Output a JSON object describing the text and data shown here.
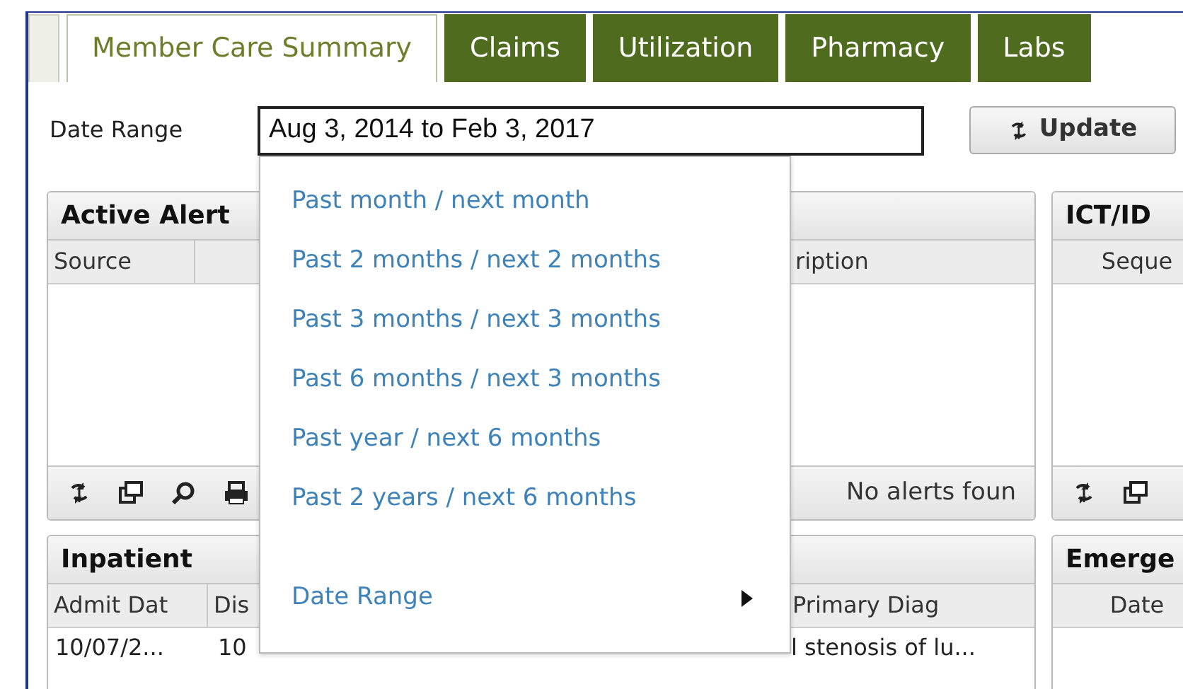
{
  "tabs": [
    {
      "label": "Member Care Summary",
      "selected": true
    },
    {
      "label": "Claims",
      "selected": false
    },
    {
      "label": "Utilization",
      "selected": false
    },
    {
      "label": "Pharmacy",
      "selected": false
    },
    {
      "label": "Labs",
      "selected": false
    }
  ],
  "date_range": {
    "label": "Date Range",
    "value": "Aug 3, 2014 to Feb 3, 2017"
  },
  "update_button": {
    "label": "Update"
  },
  "panels": [
    {
      "title": "Active Alert",
      "columns": [
        "Source",
        "ription"
      ],
      "footer_tools": [
        {
          "kind": "refresh"
        },
        {
          "kind": "window"
        },
        {
          "kind": "search"
        },
        {
          "kind": "printer"
        }
      ],
      "status": "No alerts foun"
    },
    {
      "title": "ICT/ID",
      "columns": [
        "Seque"
      ],
      "footer_tools": [
        {
          "kind": "refresh"
        },
        {
          "kind": "window"
        }
      ]
    },
    {
      "title": "Inpatient",
      "columns": [
        "Admit Dat",
        "Dis",
        "Primary Diag"
      ],
      "rows": [
        [
          "10/07/2...",
          "10",
          "l stenosis of lu..."
        ]
      ]
    },
    {
      "title": "Emerge",
      "columns": [
        "Date"
      ]
    }
  ],
  "menu": {
    "items": [
      {
        "label": "Past month / next month",
        "kind": "option"
      },
      {
        "label": "Past 2 months / next 2 months",
        "kind": "option"
      },
      {
        "label": "Past 3 months / next 3 months",
        "kind": "option"
      },
      {
        "label": "Past 6 months / next 3 months",
        "kind": "option"
      },
      {
        "label": "Past year / next 6 months",
        "kind": "option"
      },
      {
        "label": "Past 2 years / next 6 months",
        "kind": "option"
      },
      {
        "label": "Date Range",
        "kind": "submenu"
      }
    ]
  }
}
